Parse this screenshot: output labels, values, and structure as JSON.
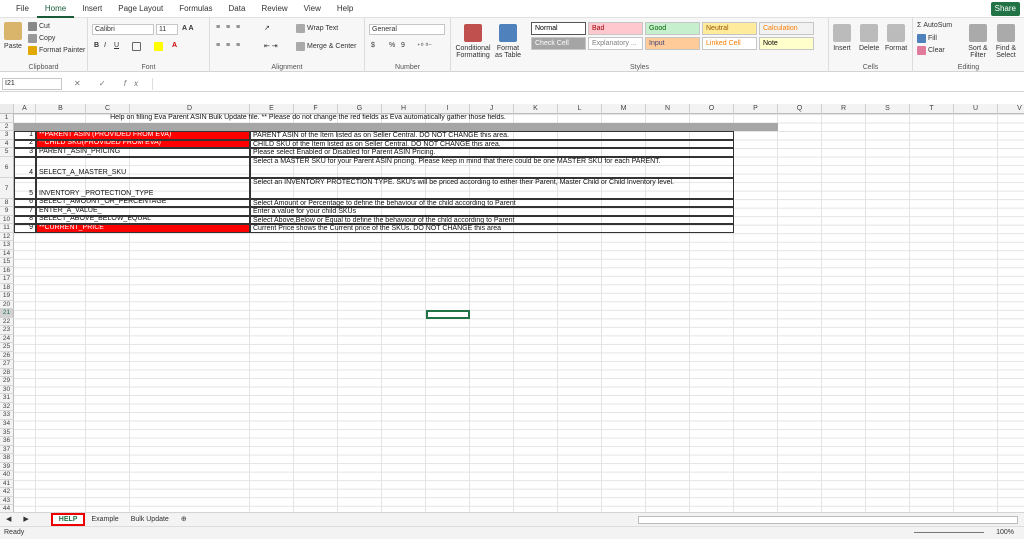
{
  "menu": {
    "tabs": [
      "File",
      "Home",
      "Insert",
      "Page Layout",
      "Formulas",
      "Data",
      "Review",
      "View",
      "Help"
    ],
    "active": "Home",
    "share": "Share"
  },
  "ribbon": {
    "clipboard": {
      "label": "Clipboard",
      "paste": "Paste",
      "cut": "Cut",
      "copy": "Copy",
      "format_painter": "Format Painter"
    },
    "font": {
      "label": "Font",
      "name": "Calibri",
      "size": "11"
    },
    "alignment": {
      "label": "Alignment",
      "wrap": "Wrap Text",
      "merge": "Merge & Center"
    },
    "number": {
      "label": "Number",
      "format": "General",
      "currency": "$",
      "percent": "%",
      "comma": "9"
    },
    "styles": {
      "label": "Styles",
      "conditional": "Conditional Formatting",
      "format_table": "Format as Table",
      "cells": [
        {
          "name": "Normal",
          "bg": "#ffffff",
          "fg": "#000000"
        },
        {
          "name": "Bad",
          "bg": "#ffc7ce",
          "fg": "#9c0006"
        },
        {
          "name": "Good",
          "bg": "#c6efce",
          "fg": "#006100"
        },
        {
          "name": "Neutral",
          "bg": "#ffeb9c",
          "fg": "#9c5700"
        },
        {
          "name": "Calculation",
          "bg": "#f2f2f2",
          "fg": "#fa7d00"
        },
        {
          "name": "Check Cell",
          "bg": "#a5a5a5",
          "fg": "#ffffff"
        },
        {
          "name": "Explanatory ...",
          "bg": "#ffffff",
          "fg": "#7f7f7f"
        },
        {
          "name": "Input",
          "bg": "#ffcc99",
          "fg": "#3f3f76"
        },
        {
          "name": "Linked Cell",
          "bg": "#ffffff",
          "fg": "#fa7d00"
        },
        {
          "name": "Note",
          "bg": "#ffffcc",
          "fg": "#000000"
        }
      ]
    },
    "cells": {
      "label": "Cells",
      "insert": "Insert",
      "delete": "Delete",
      "format": "Format"
    },
    "editing": {
      "label": "Editing",
      "autosum": "AutoSum",
      "fill": "Fill",
      "clear": "Clear",
      "sort": "Sort & Filter",
      "find": "Find & Select"
    }
  },
  "formula_bar": {
    "name_box": "I21",
    "fx": "fx"
  },
  "columns": [
    "A",
    "B",
    "C",
    "D",
    "E",
    "F",
    "G",
    "H",
    "I",
    "J",
    "K",
    "L",
    "M",
    "N",
    "O",
    "P",
    "Q",
    "R",
    "S",
    "T",
    "U",
    "V"
  ],
  "title_row": "Help on filling Eva Parent ASIN Bulk Update file. **  Please do not change the red fields as Eva automatically gather those fields.",
  "rows": [
    {
      "num": "1",
      "field": "**PARENT ASIN (PROVIDED FROM EVA)",
      "desc": "PARENT ASIN of the Item listed as on Seller Central. DO NOT CHANGE this area.",
      "red": true
    },
    {
      "num": "2",
      "field": "**CHILD SKU(PROVIDED FROM EVA)",
      "desc": "CHILD SKU of the Item listed as on Seller Central. DO NOT CHANGE this area.",
      "red": true
    },
    {
      "num": "3",
      "field": "PARENT_ASIN_PRICING",
      "desc": "Please select Enabled or Disabled for Parent ASIN Pricing.",
      "red": false
    },
    {
      "num": "4",
      "field": "SELECT_A_MASTER_SKU",
      "desc": "Select a MASTER SKU for your Parent ASIN pricing. Please keep in mind that there could be one MASTER SKU for each PARENT.",
      "red": false
    },
    {
      "num": "5",
      "field": "INVENTORY _PROTECTION_TYPE",
      "desc": "Select an INVENTORY PROTECTION TYPE. SKU's will be priced according to either their Parent, Master Child or Child Inventory level.",
      "red": false
    },
    {
      "num": "6",
      "field": "SELECT_AMOUNT_OR_PERCENTAGE",
      "desc": "Select Amount or Percentage to define the behaviour of the child according to Parent",
      "red": false
    },
    {
      "num": "7",
      "field": "ENTER_A_VALUE_",
      "desc": "Enter a value for your child SKUs",
      "red": false
    },
    {
      "num": "8",
      "field": "SELECT_ABOVE_BELOW_EQUAL",
      "desc": "Select Above,Below or Equal to define the behaviour of the child according to Parent",
      "red": false
    },
    {
      "num": "9",
      "field": "**CURRENT_PRICE",
      "desc": "Current Price shows the Current price of the SKUs. DO NOT CHANGE this area",
      "red": true
    }
  ],
  "sheets": [
    "HELP",
    "Example",
    "Bulk Update"
  ],
  "active_sheet": "HELP",
  "status": "Ready",
  "zoom": "100"
}
